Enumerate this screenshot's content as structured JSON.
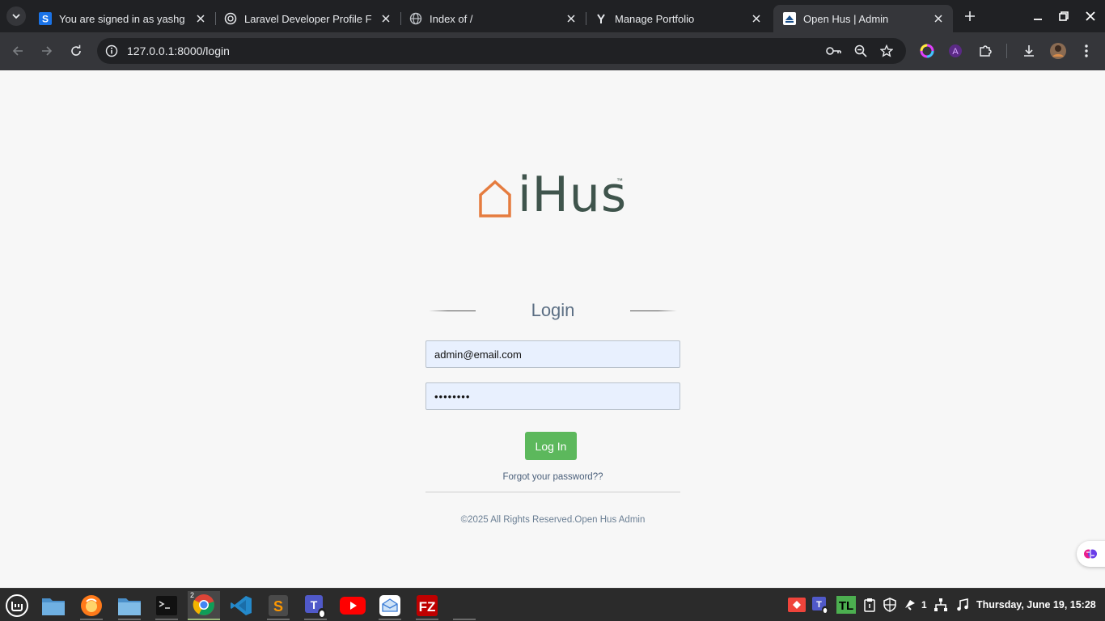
{
  "browser": {
    "tabs": [
      {
        "title": "You are signed in as yashg",
        "favicon": "s-square-icon",
        "active": false
      },
      {
        "title": "Laravel Developer Profile F",
        "favicon": "openai-icon",
        "active": false
      },
      {
        "title": "Index of /",
        "favicon": "globe-icon",
        "active": false
      },
      {
        "title": "Manage Portfolio",
        "favicon": "y-logo-icon",
        "active": false
      },
      {
        "title": "Open Hus | Admin",
        "favicon": "site-logo-icon",
        "active": true
      }
    ],
    "url": "127.0.0.1:8000/login"
  },
  "page": {
    "logo_text": "iHus",
    "logo_tm": "™",
    "login_heading": "Login",
    "email_value": "admin@email.com",
    "password_value": "••••••••",
    "login_button": "Log In",
    "forgot_link": "Forgot your password??",
    "copyright": "©2025 All Rights Reserved.Open Hus Admin"
  },
  "colors": {
    "brand_orange": "#e57c3f",
    "brand_dark": "#3f544c",
    "button_green": "#5cb85c"
  },
  "taskbar": {
    "chrome_badge": "2",
    "tray_count": "1",
    "clock": "Thursday, June 19, 15:28"
  }
}
